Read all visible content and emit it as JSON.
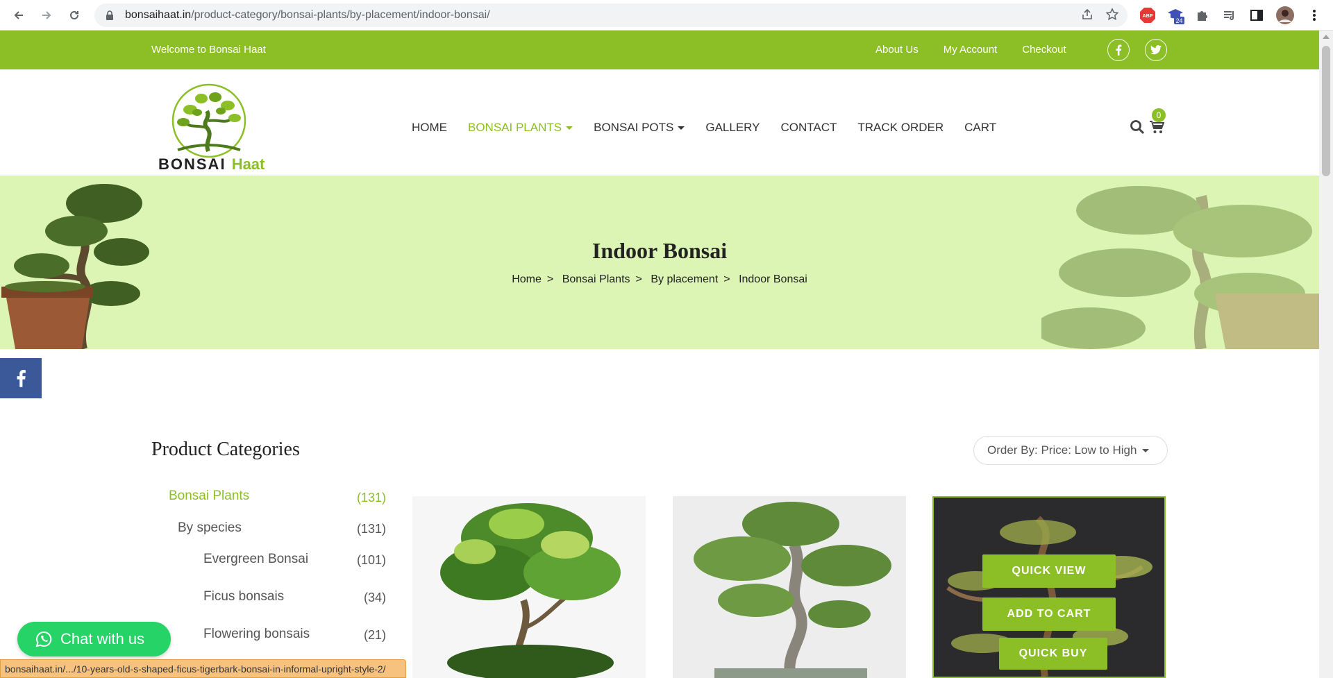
{
  "browser": {
    "url_host": "bonsaihaat.in",
    "url_path": "/product-category/bonsai-plants/by-placement/indoor-bonsai/",
    "extension_badge": "24"
  },
  "topbar": {
    "welcome": "Welcome to Bonsai Haat",
    "links": [
      "About Us",
      "My Account",
      "Checkout"
    ],
    "colors": {
      "bar": "#8cbf26"
    }
  },
  "logo": {
    "word_a": "BONSAI",
    "word_b": "Haat"
  },
  "nav": {
    "items": [
      {
        "label": "HOME"
      },
      {
        "label": "BONSAI PLANTS",
        "active": true,
        "dropdown": true
      },
      {
        "label": "BONSAI POTS",
        "dropdown": true
      },
      {
        "label": "GALLERY"
      },
      {
        "label": "CONTACT"
      },
      {
        "label": "TRACK ORDER"
      },
      {
        "label": "CART"
      }
    ],
    "cart_count": "0"
  },
  "hero": {
    "title": "Indoor Bonsai",
    "breadcrumb": [
      "Home",
      "Bonsai Plants",
      "By placement",
      "Indoor Bonsai"
    ],
    "separator": ">"
  },
  "sidebar": {
    "title": "Product Categories",
    "categories": [
      {
        "label": "Bonsai Plants",
        "count": "(131)"
      },
      {
        "label": "By species",
        "count": "(131)"
      },
      {
        "label": "Evergreen Bonsai",
        "count": "(101)"
      },
      {
        "label": "Ficus bonsais",
        "count": "(34)"
      },
      {
        "label": "Flowering bonsais",
        "count": "(21)"
      }
    ]
  },
  "orderby": {
    "label": "Order By: Price: Low to High"
  },
  "product_actions": {
    "quick_view": "QUICK VIEW",
    "add_to_cart": "ADD TO CART",
    "quick_buy": "QUICK BUY"
  },
  "chat": {
    "label": "Chat with us"
  },
  "status_url": "bonsaihaat.in/.../10-years-old-s-shaped-ficus-tigerbark-bonsai-in-informal-upright-style-2/"
}
